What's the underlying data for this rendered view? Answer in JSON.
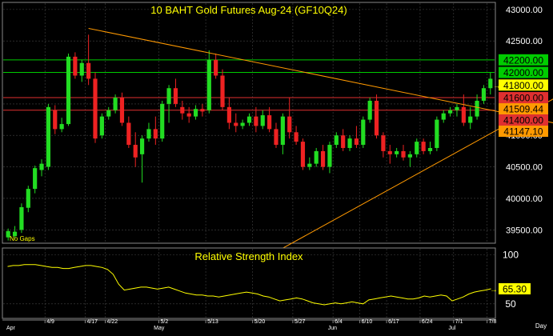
{
  "chart_data": [
    {
      "type": "candlestick",
      "title": "10  BAHT  Gold  Futures  Aug-24  (GF10Q24)",
      "note": "No Gaps",
      "ylim": [
        39300,
        43100
      ],
      "y_ticks": [
        39500,
        40000,
        40500,
        41000,
        41500,
        42000,
        42500,
        43000
      ],
      "y_tick_labels": [
        "39500.00",
        "40000.00",
        "40500.00",
        "41000.00",
        "41500.00",
        "42000.00",
        "42500.00",
        "43000.00"
      ],
      "x_day_labels": [
        "4/9",
        "4/17",
        "4/22",
        "5/2",
        "5/13",
        "5/20",
        "5/27",
        "6/4",
        "6/10",
        "6/17",
        "6/24",
        "7/1",
        "7/8"
      ],
      "x_month_labels": [
        "Apr",
        "May",
        "Jun",
        "Jul"
      ],
      "x_axis_unit": "Day",
      "candles": [
        {
          "o": 39380,
          "h": 39520,
          "l": 39330,
          "c": 39480
        },
        {
          "o": 39400,
          "h": 39560,
          "l": 39360,
          "c": 39470
        },
        {
          "o": 39500,
          "h": 39920,
          "l": 39450,
          "c": 39860
        },
        {
          "o": 39850,
          "h": 40200,
          "l": 39780,
          "c": 40150
        },
        {
          "o": 40150,
          "h": 40520,
          "l": 40080,
          "c": 40480
        },
        {
          "o": 40450,
          "h": 40620,
          "l": 40350,
          "c": 40550
        },
        {
          "o": 40500,
          "h": 41500,
          "l": 40450,
          "c": 41450
        },
        {
          "o": 41400,
          "h": 41480,
          "l": 41020,
          "c": 41100
        },
        {
          "o": 41100,
          "h": 41280,
          "l": 41050,
          "c": 41180
        },
        {
          "o": 41180,
          "h": 42300,
          "l": 41150,
          "c": 42250
        },
        {
          "o": 42250,
          "h": 42320,
          "l": 41900,
          "c": 41950
        },
        {
          "o": 41950,
          "h": 42200,
          "l": 41850,
          "c": 42150
        },
        {
          "o": 42150,
          "h": 42600,
          "l": 41800,
          "c": 41900
        },
        {
          "o": 41900,
          "h": 42000,
          "l": 40880,
          "c": 40950
        },
        {
          "o": 41000,
          "h": 41350,
          "l": 40950,
          "c": 41300
        },
        {
          "o": 41300,
          "h": 41450,
          "l": 41250,
          "c": 41400
        },
        {
          "o": 41400,
          "h": 41650,
          "l": 41350,
          "c": 41600
        },
        {
          "o": 41600,
          "h": 41680,
          "l": 41150,
          "c": 41200
        },
        {
          "o": 41200,
          "h": 41300,
          "l": 40800,
          "c": 40850
        },
        {
          "o": 40850,
          "h": 41050,
          "l": 40500,
          "c": 40650
        },
        {
          "o": 40700,
          "h": 41000,
          "l": 40250,
          "c": 40950
        },
        {
          "o": 40950,
          "h": 41200,
          "l": 40900,
          "c": 41100
        },
        {
          "o": 41100,
          "h": 41300,
          "l": 40850,
          "c": 40950
        },
        {
          "o": 40950,
          "h": 41550,
          "l": 40900,
          "c": 41500
        },
        {
          "o": 41500,
          "h": 41800,
          "l": 41200,
          "c": 41750
        },
        {
          "o": 41750,
          "h": 41900,
          "l": 41450,
          "c": 41500
        },
        {
          "o": 41450,
          "h": 41550,
          "l": 41250,
          "c": 41350
        },
        {
          "o": 41350,
          "h": 41450,
          "l": 41200,
          "c": 41300
        },
        {
          "o": 41300,
          "h": 41480,
          "l": 41250,
          "c": 41420
        },
        {
          "o": 41420,
          "h": 41500,
          "l": 41300,
          "c": 41380
        },
        {
          "o": 41400,
          "h": 42350,
          "l": 41350,
          "c": 42200
        },
        {
          "o": 42200,
          "h": 42300,
          "l": 41900,
          "c": 41950
        },
        {
          "o": 41950,
          "h": 42050,
          "l": 41400,
          "c": 41450
        },
        {
          "o": 41450,
          "h": 41600,
          "l": 41100,
          "c": 41200
        },
        {
          "o": 41200,
          "h": 41350,
          "l": 41050,
          "c": 41150
        },
        {
          "o": 41150,
          "h": 41250,
          "l": 41100,
          "c": 41200
        },
        {
          "o": 41200,
          "h": 41350,
          "l": 41150,
          "c": 41300
        },
        {
          "o": 41300,
          "h": 41450,
          "l": 41050,
          "c": 41150
        },
        {
          "o": 41150,
          "h": 41400,
          "l": 41100,
          "c": 41320
        },
        {
          "o": 41320,
          "h": 41450,
          "l": 41050,
          "c": 41100
        },
        {
          "o": 41100,
          "h": 41200,
          "l": 40800,
          "c": 40850
        },
        {
          "o": 40850,
          "h": 41350,
          "l": 40700,
          "c": 41300
        },
        {
          "o": 41300,
          "h": 41600,
          "l": 40950,
          "c": 41050
        },
        {
          "o": 41050,
          "h": 41150,
          "l": 40850,
          "c": 40900
        },
        {
          "o": 40900,
          "h": 40950,
          "l": 40450,
          "c": 40500
        },
        {
          "o": 40500,
          "h": 40650,
          "l": 40450,
          "c": 40550
        },
        {
          "o": 40550,
          "h": 40800,
          "l": 40500,
          "c": 40750
        },
        {
          "o": 40750,
          "h": 40850,
          "l": 40450,
          "c": 40500
        },
        {
          "o": 40500,
          "h": 40900,
          "l": 40400,
          "c": 40850
        },
        {
          "o": 40850,
          "h": 41050,
          "l": 40800,
          "c": 41000
        },
        {
          "o": 41000,
          "h": 41100,
          "l": 40750,
          "c": 40800
        },
        {
          "o": 40800,
          "h": 41000,
          "l": 40750,
          "c": 40950
        },
        {
          "o": 40950,
          "h": 41150,
          "l": 40800,
          "c": 40850
        },
        {
          "o": 40850,
          "h": 41300,
          "l": 40800,
          "c": 41250
        },
        {
          "o": 41250,
          "h": 41600,
          "l": 41200,
          "c": 41550
        },
        {
          "o": 41550,
          "h": 41650,
          "l": 40950,
          "c": 41000
        },
        {
          "o": 41000,
          "h": 41050,
          "l": 40650,
          "c": 40750
        },
        {
          "o": 40750,
          "h": 40850,
          "l": 40550,
          "c": 40700
        },
        {
          "o": 40700,
          "h": 40800,
          "l": 40650,
          "c": 40750
        },
        {
          "o": 40750,
          "h": 40850,
          "l": 40600,
          "c": 40650
        },
        {
          "o": 40650,
          "h": 40750,
          "l": 40500,
          "c": 40700
        },
        {
          "o": 40700,
          "h": 40950,
          "l": 40650,
          "c": 40900
        },
        {
          "o": 40900,
          "h": 40950,
          "l": 40700,
          "c": 40750
        },
        {
          "o": 40750,
          "h": 40900,
          "l": 40700,
          "c": 40800
        },
        {
          "o": 40800,
          "h": 41300,
          "l": 40750,
          "c": 41250
        },
        {
          "o": 41250,
          "h": 41400,
          "l": 41200,
          "c": 41350
        },
        {
          "o": 41350,
          "h": 41450,
          "l": 41300,
          "c": 41400
        },
        {
          "o": 41400,
          "h": 41500,
          "l": 41300,
          "c": 41450
        },
        {
          "o": 41450,
          "h": 41650,
          "l": 41150,
          "c": 41200
        },
        {
          "o": 41200,
          "h": 41450,
          "l": 41100,
          "c": 41300
        },
        {
          "o": 41300,
          "h": 41650,
          "l": 41250,
          "c": 41550
        },
        {
          "o": 41550,
          "h": 41800,
          "l": 41500,
          "c": 41750
        },
        {
          "o": 41750,
          "h": 42000,
          "l": 41650,
          "c": 41900
        }
      ],
      "trendlines": [
        {
          "from": [
            12,
            42700
          ],
          "to": [
            86,
            41100
          ]
        },
        {
          "from": [
            40,
            39150
          ],
          "to": [
            86,
            41850
          ]
        }
      ],
      "levels": [
        {
          "value": 42200,
          "label": "42200.00",
          "color": "#00cc00",
          "label_bg": "#00cc00",
          "label_fg": "#000000"
        },
        {
          "value": 42000,
          "label": "42000.00",
          "color": "#00cc00",
          "label_bg": "#00cc00",
          "label_fg": "#000000"
        },
        {
          "value": 41600,
          "label": "41600.00",
          "color": "#e03030",
          "label_bg": "#e03030",
          "label_fg": "#000000"
        },
        {
          "value": 41400,
          "label": "41400.00",
          "color": "#e03030",
          "label_bg": "#e03030",
          "label_fg": "#000000"
        }
      ],
      "price_labels": [
        {
          "value": 41800,
          "label": "41800.00",
          "label_bg": "#ffff00",
          "label_fg": "#000000"
        },
        {
          "value": 41509.44,
          "label": "41509.44",
          "label_bg": "#ff9900",
          "label_fg": "#000000"
        },
        {
          "value": 41147.1,
          "label": "41147.10",
          "label_bg": "#ff9900",
          "label_fg": "#000000"
        }
      ],
      "colors": {
        "up": "#22dd22",
        "down": "#ee2222",
        "trendline": "#ff9900",
        "grid": "#444444",
        "text": "#ffff00",
        "axis_text": "#ffffff"
      }
    },
    {
      "type": "line",
      "title": "Relative Strength Index",
      "ylim": [
        36,
        106
      ],
      "y_ticks": [
        50,
        100
      ],
      "y_tick_labels": [
        "50",
        "100"
      ],
      "last_value_label": "65.30",
      "values": [
        88,
        89,
        89,
        90,
        90,
        90,
        89,
        88,
        87,
        87,
        86,
        86,
        87,
        88,
        89,
        89,
        88,
        87,
        85,
        80,
        70,
        64,
        65,
        66,
        67,
        67,
        66,
        65,
        66,
        67,
        65,
        63,
        61,
        60,
        59,
        59,
        58,
        58,
        57,
        58,
        59,
        60,
        61,
        62,
        61,
        60,
        58,
        57,
        55,
        53,
        54,
        55,
        56,
        55,
        53,
        51,
        50,
        49,
        50,
        51,
        50,
        51,
        52,
        51,
        50,
        54,
        55,
        56,
        57,
        58,
        57,
        56,
        55,
        55,
        56,
        58,
        57,
        58,
        59,
        58,
        53,
        55,
        57,
        60,
        62,
        63,
        64,
        65.3
      ],
      "colors": {
        "line": "#ffff00",
        "label_bg": "#ffff00",
        "label_fg": "#000000"
      }
    }
  ]
}
